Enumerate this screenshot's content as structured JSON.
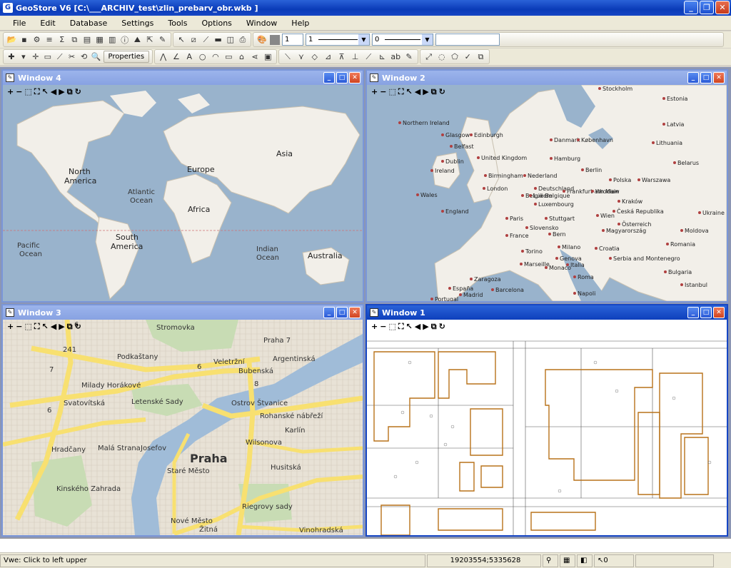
{
  "app": {
    "title": "GeoStore V6 [C:\\___ARCHIV_test\\zlin_prebarv_obr.wkb ]"
  },
  "menu": [
    "File",
    "Edit",
    "Database",
    "Settings",
    "Tools",
    "Options",
    "Window",
    "Help"
  ],
  "toolbar": {
    "width_value": "1",
    "line_value": "1",
    "fill_value": "0",
    "properties_label": "Properties"
  },
  "windows": {
    "w4": {
      "title": "Window 4"
    },
    "w2": {
      "title": "Window 2"
    },
    "w3": {
      "title": "Window 3"
    },
    "w1": {
      "title": "Window 1"
    }
  },
  "world_labels": {
    "north_america": [
      "North",
      "America"
    ],
    "atlantic": [
      "Atlantic",
      "Ocean"
    ],
    "europe": "Europe",
    "asia": "Asia",
    "africa": "Africa",
    "south_america": [
      "South",
      "America"
    ],
    "pacific": [
      "Pacific",
      "Ocean"
    ],
    "indian": [
      "Indian",
      "Ocean"
    ],
    "australia": "Australia"
  },
  "europe_labels": [
    "Stockholm",
    "Estonia",
    "Latvia",
    "Lithuania",
    "Belarus",
    "Danmark",
    "København",
    "Hamburg",
    "Berlin",
    "Nederland",
    "Polska",
    "Warszawa",
    "Deutschland",
    "Frankfurt am Main",
    "Wrocław",
    "Kraków",
    "Česká Republika",
    "België Belgique",
    "Luxembourg",
    "Paris",
    "Stuttgart",
    "Wien",
    "Slovensko",
    "Österreich",
    "Bern",
    "Magyarország",
    "Moldova",
    "Ukraine",
    "Romania",
    "France",
    "Torino",
    "Milano",
    "Croatia",
    "Genova",
    "Monaco",
    "Serbia and Montenegro",
    "Bulgaria",
    "Marseille",
    "Italia",
    "Roma",
    "Napoli",
    "Istanbul",
    "Zaragoza",
    "España",
    "Madrid",
    "Barcelona",
    "Portugal",
    "Northern Ireland",
    "Glasgow",
    "Edinburgh",
    "Belfast",
    "Ireland",
    "Dublin",
    "United Kingdom",
    "Birmingham",
    "London",
    "Wales",
    "England",
    "Luxem"
  ],
  "prague_labels": [
    "Stromovka",
    "Praha 7",
    "Veletržní",
    "Bubenská",
    "Argentinská",
    "Podkaštany",
    "Letenské Sady",
    "Ostrov Štvanice",
    "Milady Horákové",
    "Svatovítská",
    "Rohanské nábřeží",
    "Karlín",
    "Wilsonova",
    "Hradčany",
    "Malá Strana",
    "Josefov",
    "Praha",
    "Staré Město",
    "Husitská",
    "Kinského Zahrada",
    "Nové Město",
    "Žitná",
    "Riegrovy sady",
    "Vinohradská",
    "241",
    "6",
    "7",
    "6",
    "8",
    "6"
  ],
  "status": {
    "message": "Vwe: Click to left upper",
    "coords": "19203554;5335628",
    "count": "0"
  }
}
